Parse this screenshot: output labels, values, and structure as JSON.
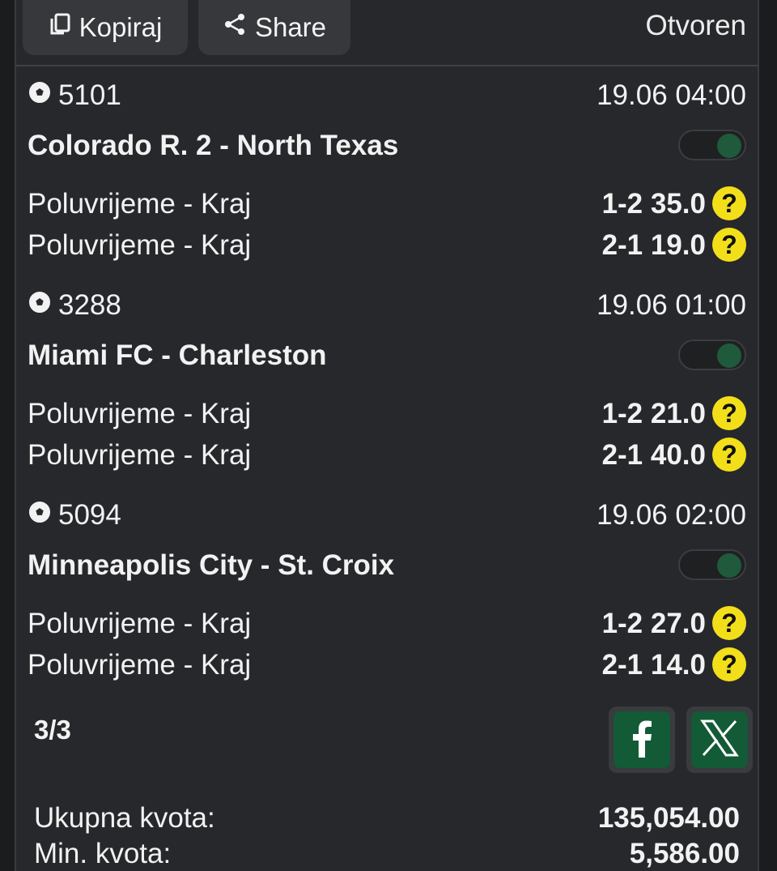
{
  "toolbar": {
    "copy_label": "Kopiraj",
    "share_label": "Share",
    "status": "Otvoren"
  },
  "matches": [
    {
      "code": "5101",
      "datetime": "19.06 04:00",
      "teams": "Colorado R. 2 - North Texas",
      "toggle_on": true,
      "picks": [
        {
          "market": "Poluvrijeme - Kraj",
          "odds": "1-2 35.0"
        },
        {
          "market": "Poluvrijeme - Kraj",
          "odds": "2-1 19.0"
        }
      ]
    },
    {
      "code": "3288",
      "datetime": "19.06 01:00",
      "teams": "Miami FC - Charleston",
      "toggle_on": true,
      "picks": [
        {
          "market": "Poluvrijeme - Kraj",
          "odds": "1-2 21.0"
        },
        {
          "market": "Poluvrijeme - Kraj",
          "odds": "2-1 40.0"
        }
      ]
    },
    {
      "code": "5094",
      "datetime": "19.06 02:00",
      "teams": "Minneapolis City - St. Croix",
      "toggle_on": true,
      "picks": [
        {
          "market": "Poluvrijeme - Kraj",
          "odds": "1-2 27.0"
        },
        {
          "market": "Poluvrijeme - Kraj",
          "odds": "2-1 14.0"
        }
      ]
    }
  ],
  "footer": {
    "count": "3/3",
    "total_odds_label": "Ukupna kvota:",
    "total_odds_value": "135,054.00",
    "min_odds_label": "Min. kvota:",
    "min_odds_value": "5,586.00"
  },
  "icons": {
    "copy": "copy-icon",
    "share": "share-icon",
    "sport": "soccer-ball-icon",
    "help": "question-mark-icon",
    "facebook": "facebook-icon",
    "x": "x-icon"
  },
  "colors": {
    "accent_green": "#135a37",
    "help_yellow": "#f2df1a",
    "panel_bg": "#27282b"
  }
}
